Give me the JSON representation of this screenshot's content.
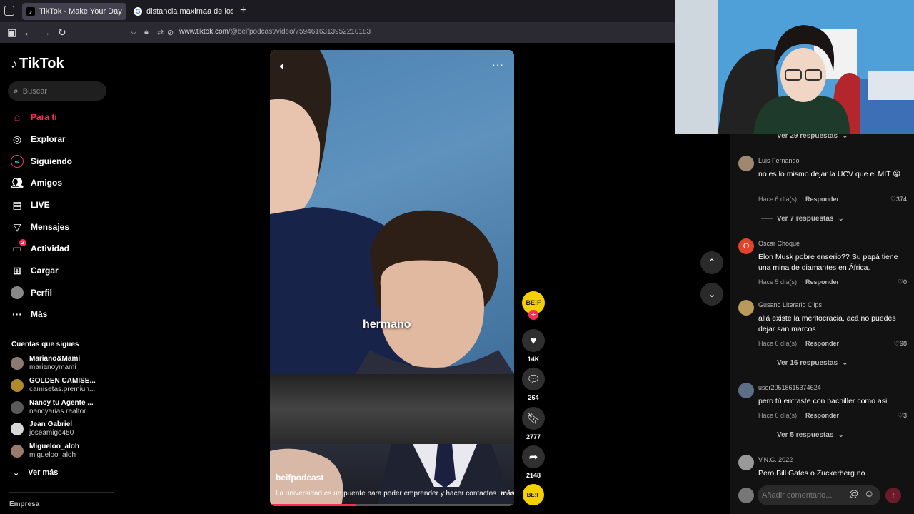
{
  "browser": {
    "tabs": [
      {
        "title": "TikTok - Make Your Day",
        "active": true
      },
      {
        "title": "distancia maximaa de los misile"
      }
    ],
    "url_domain": "www.tiktok.com",
    "url_path": "/@beifpodcast/video/7594616313952210183"
  },
  "sidebar": {
    "logo": "TikTok",
    "search_placeholder": "Buscar",
    "nav": [
      {
        "label": "Para ti",
        "icon": "home-icon"
      },
      {
        "label": "Explorar",
        "icon": "compass-icon"
      },
      {
        "label": "Siguiendo",
        "icon": "following-icon"
      },
      {
        "label": "Amigos",
        "icon": "friends-icon"
      },
      {
        "label": "LIVE",
        "icon": "live-icon"
      },
      {
        "label": "Mensajes",
        "icon": "messages-icon"
      },
      {
        "label": "Actividad",
        "icon": "activity-icon",
        "badge": "2"
      },
      {
        "label": "Cargar",
        "icon": "upload-icon"
      },
      {
        "label": "Perfil",
        "icon": "profile-avatar"
      },
      {
        "label": "Más",
        "icon": "more-icon"
      }
    ],
    "following_title": "Cuentas que sigues",
    "following": [
      {
        "name": "Mariano&Mami",
        "user": "marianoymami"
      },
      {
        "name": "GOLDEN CAMISE...",
        "user": "camisetas.premiun..."
      },
      {
        "name": "Nancy tu Agente ...",
        "user": "nancyarias.realtor"
      },
      {
        "name": "Jean Gabriel",
        "user": "joseamigo450"
      },
      {
        "name": "Migueloo_aloh",
        "user": "migueloo_aloh"
      }
    ],
    "see_more": "Ver más",
    "footer": "Empresa"
  },
  "video": {
    "caption": "hermano",
    "author": "beifpodcast",
    "description": "La universidad es un puente para poder emprender y hacer contactos",
    "more": "más",
    "progress": 0.35
  },
  "actions": {
    "avatar_text": "BE!F",
    "likes": "14K",
    "comments": "264",
    "saves": "2777",
    "shares": "2148"
  },
  "comments": {
    "top_replies": "Ver 29 respuestas",
    "items": [
      {
        "user": "Luis Fernando",
        "text": "no es lo mismo dejar la UCV que el MIT 😝",
        "time": "Hace 6 día(s)",
        "reply": "Responder",
        "likes": "374",
        "replies": "Ver 7 respuestas"
      },
      {
        "user": "Oscar Choque",
        "initial": "O",
        "text": "Elon Musk pobre enserio?? Su papá tiene una mina de diamantes en África.",
        "time": "Hace 5 día(s)",
        "reply": "Responder",
        "likes": "0"
      },
      {
        "user": "Gusano Literario Clips",
        "text": "allá existe la meritocracia, acá no puedes dejar san marcos",
        "time": "Hace 6 día(s)",
        "reply": "Responder",
        "likes": "98",
        "replies": "Ver 16 respuestas"
      },
      {
        "user": "user20518615374624",
        "text": "pero tú entraste con bachiller como asi",
        "time": "Hace 6 día(s)",
        "reply": "Responder",
        "likes": "3",
        "replies": "Ver 5 respuestas"
      },
      {
        "user": "V.N.C. 2022",
        "text": "Pero Bill Gates o Zuckerberg no"
      }
    ],
    "input_placeholder": "Añadir comentario..."
  }
}
